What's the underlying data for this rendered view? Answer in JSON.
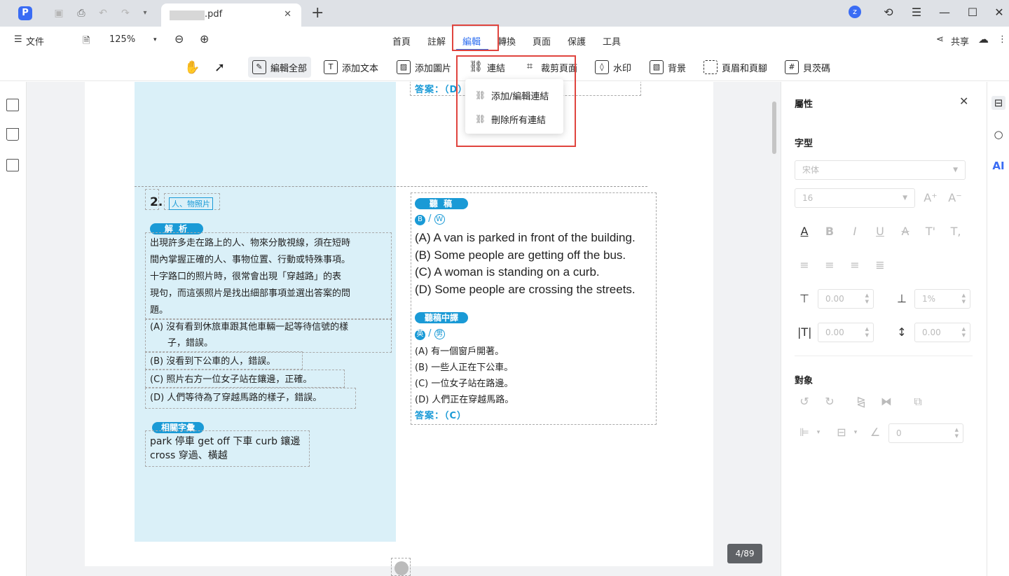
{
  "titlebar": {
    "tab_name": ".pdf",
    "avatar_letter": "z"
  },
  "menubar": {
    "file_label": "文件",
    "zoom": "125%",
    "tabs": [
      "首頁",
      "註解",
      "編輯",
      "轉換",
      "頁面",
      "保護",
      "工具"
    ],
    "active_tab": "編輯",
    "share_label": "共享"
  },
  "toolbar": {
    "edit_all": "編輯全部",
    "add_text": "添加文本",
    "add_image": "添加圖片",
    "link": "連結",
    "crop_page": "裁剪頁面",
    "watermark": "水印",
    "background": "背景",
    "header_footer": "頁眉和頁腳",
    "bates": "貝茨碼"
  },
  "link_menu": {
    "items": [
      "添加/編輯連結",
      "刪除所有連結"
    ]
  },
  "document": {
    "top_answer": "答案：（D）",
    "question_number": "2.",
    "category_tag": "人、物照片",
    "analysis_label": "解 析",
    "analysis_lines": [
      "出現許多走在路上的人、物來分散視線，須在短時",
      "間內掌握正確的人、事物位置、行動或特殊事項。",
      "十字路口的照片時，很常會出現「穿越路」的表",
      "現句，而這張照片是找出細部事項並選出答案的問",
      "題。"
    ],
    "choice_a_line1": "(A) 沒有看到休旅車跟其他車輛一起等待信號的樣",
    "choice_a_line2": "子，錯誤。",
    "choice_b": "(B) 沒看到下公車的人，錯誤。",
    "choice_c": "(C) 照片右方一位女子站在鑲邊，正確。",
    "choice_d": "(D) 人們等待為了穿越馬路的樣子，錯誤。",
    "vocab_label": "相關字彙",
    "vocab_line1": "park 停車  get off 下車  curb 鑲邊",
    "vocab_line2": "cross 穿過、橫越",
    "script_label": "聽 稿",
    "speaker_b": "B",
    "speaker_w": "W",
    "script_lines": [
      "(A) A van is parked in front of the building.",
      "(B) Some people are getting off the bus.",
      "(C) A woman is standing on a curb.",
      "(D) Some people are crossing the streets."
    ],
    "translation_label": "聽稿中譯",
    "speaker_ying": "英",
    "speaker_nan": "男",
    "translation_lines": [
      "(A) 有一個窗戶開著。",
      "(B) 一些人正在下公車。",
      "(C) 一位女子站在路邊。",
      "(D) 人們正在穿越馬路。"
    ],
    "answer": "答案：（C）",
    "page_counter": "4/89"
  },
  "properties": {
    "title": "屬性",
    "font_section": "字型",
    "font_family": "宋体",
    "font_size": "16",
    "line_spacing": "0.00",
    "char_spacing": "1%",
    "indent": "0.00",
    "para_spacing": "0.00",
    "object_section": "對象",
    "rotation": "0"
  },
  "colors": {
    "accent": "#2f6ff0",
    "highlight_red": "#e0443e",
    "doc_blue": "#1a9ad6",
    "panel_blue": "#daf0f8"
  }
}
